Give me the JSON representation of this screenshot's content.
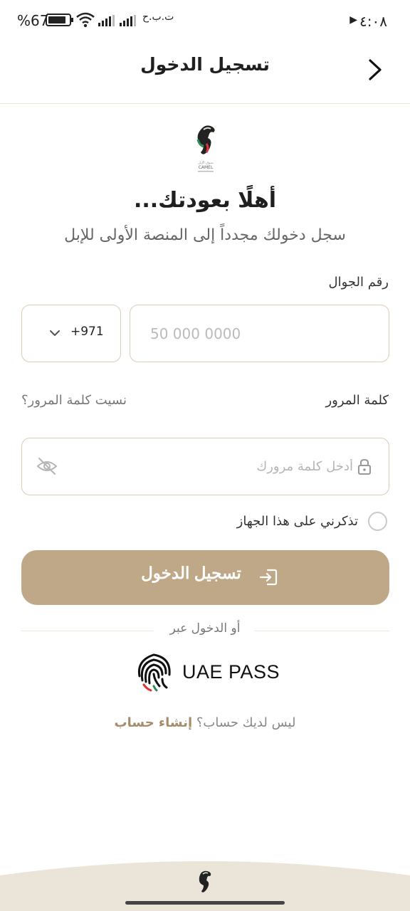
{
  "status_bar": {
    "time": "٤:٠٨",
    "battery_percent": "%67",
    "carrier": "ت.ب.ح"
  },
  "header": {
    "title": "تسجيل الدخول",
    "back_icon": "chevron-right-icon"
  },
  "brand": {
    "logo_icon": "camel-logo-icon",
    "logo_text": "CAMEL"
  },
  "welcome": {
    "title": "أهلًا بعودتك...",
    "subtitle": "سجل دخولك مجدداً إلى المنصة الأولى للإبل"
  },
  "phone": {
    "label": "رقم الجوال",
    "country_code": "+971",
    "placeholder": "50 000 0000"
  },
  "password": {
    "label": "كلمة المرور",
    "forgot_label": "نسيت كلمة المرور؟",
    "placeholder": "أدخل كلمة مرورك"
  },
  "remember_me": {
    "label": "تذكرني على هذا الجهاز",
    "checked": false
  },
  "login_button": {
    "label": "تسجيل الدخول",
    "icon": "login-icon"
  },
  "alt_login": {
    "divider_text": "أو الدخول عبر",
    "uae_pass_label": "UAE PASS"
  },
  "signup": {
    "question": "ليس لديك حساب؟",
    "link": "إنشاء حساب"
  },
  "colors": {
    "accent": "#bfa888",
    "accent_dark": "#a38d6c",
    "border": "#d9cdb4",
    "footer": "#ebe4d8"
  }
}
